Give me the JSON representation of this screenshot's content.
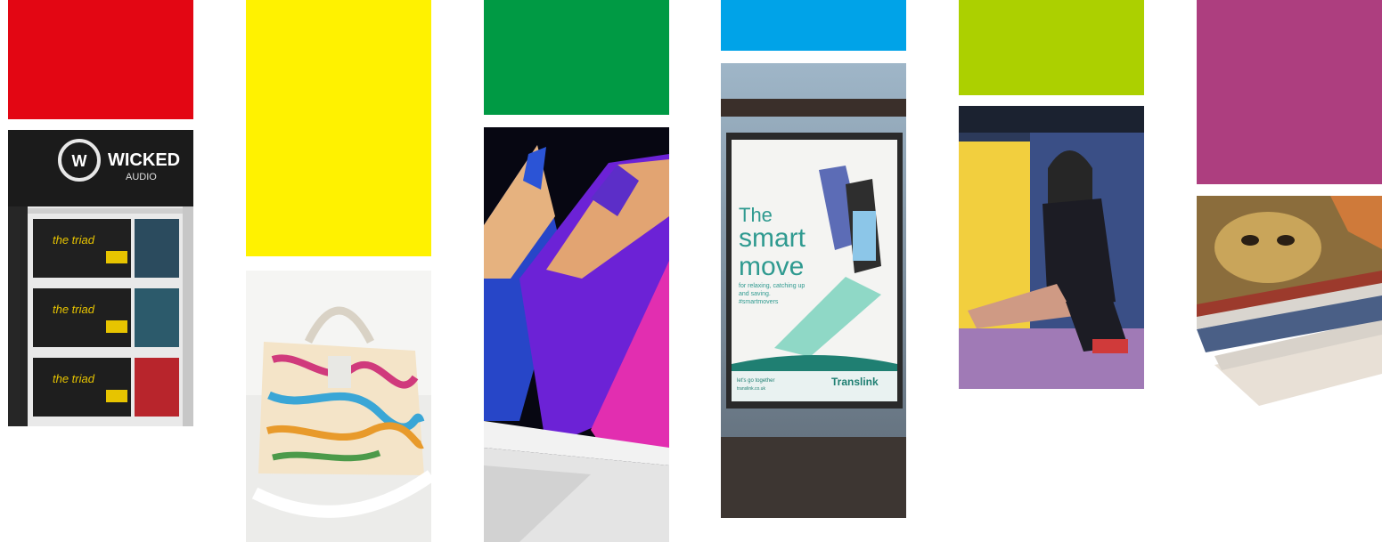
{
  "swatches": {
    "red": "#e30613",
    "yellow": "#fff200",
    "green": "#009a44",
    "cyan": "#00a3e8",
    "lime": "#acd000",
    "magenta": "#ad3e7f"
  },
  "photos": {
    "retail": {
      "icon": "retail-display-photo",
      "logo_brand": "WICKED",
      "logo_sub": "AUDIO",
      "product_line": "the triad"
    },
    "handbag": {
      "icon": "graffiti-handbag-photo"
    },
    "pencils": {
      "icon": "colored-pencils-photo"
    },
    "billboard": {
      "icon": "bus-shelter-billboard-photo",
      "headline_1": "The",
      "headline_2": "smart",
      "headline_3": "move",
      "tagline_1": "for relaxing, catching up",
      "tagline_2": "and saving.",
      "hashtag": "#smartmovers",
      "footer_1": "let's go together",
      "footer_2": "translink.co.uk",
      "brand": "Translink"
    },
    "model": {
      "icon": "lightbox-model-photo"
    },
    "boards": {
      "icon": "stacked-print-boards-photo"
    }
  }
}
